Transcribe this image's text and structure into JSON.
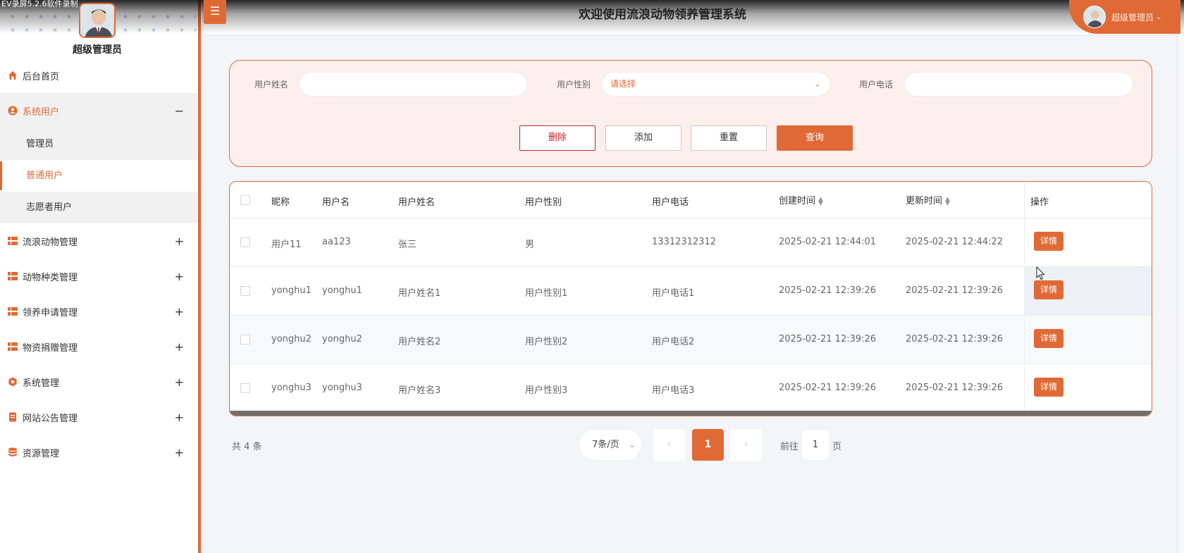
{
  "recorder_label": "EV录屏5.2.6软件录制",
  "header": {
    "menu_icon": "☰",
    "title": "欢迎使用流浪动物领养管理系统",
    "user": "超级管理员"
  },
  "sidebar": {
    "admin_name": "超级管理员",
    "items": [
      {
        "label": "后台首页",
        "icon": "home-icon"
      },
      {
        "label": "系统用户",
        "icon": "user-circle-icon",
        "toggle": "−",
        "expanded": true,
        "children": [
          {
            "label": "管理员"
          },
          {
            "label": "普通用户",
            "active": true
          },
          {
            "label": "志愿者用户"
          }
        ]
      },
      {
        "label": "流浪动物管理",
        "icon": "grid-icon",
        "toggle": "+"
      },
      {
        "label": "动物种类管理",
        "icon": "grid-icon",
        "toggle": "+"
      },
      {
        "label": "领养申请管理",
        "icon": "grid-icon",
        "toggle": "+"
      },
      {
        "label": "物资捐赠管理",
        "icon": "grid-icon",
        "toggle": "+"
      },
      {
        "label": "系统管理",
        "icon": "gear-icon",
        "toggle": "+"
      },
      {
        "label": "网站公告管理",
        "icon": "notice-icon",
        "toggle": "+"
      },
      {
        "label": "资源管理",
        "icon": "database-icon",
        "toggle": "+"
      }
    ]
  },
  "search": {
    "name_label": "用户姓名",
    "name_value": "",
    "gender_label": "用户性别",
    "gender_placeholder": "请选择",
    "phone_label": "用户电话",
    "phone_value": "",
    "buttons": {
      "delete": "删除",
      "add": "添加",
      "reset": "重置",
      "query": "查询"
    }
  },
  "table": {
    "headers": [
      "昵称",
      "用户名",
      "用户姓名",
      "用户性别",
      "用户电话",
      "创建时间",
      "更新时间",
      "操作"
    ],
    "rows": [
      {
        "nickname": "用户11",
        "username": "aa123",
        "realname": "张三",
        "gender": "男",
        "phone": "13312312312",
        "created": "2025-02-21 12:44:01",
        "updated": "2025-02-21 12:44:22",
        "action": "详情"
      },
      {
        "nickname": "yonghu1",
        "username": "yonghu1",
        "realname": "用户姓名1",
        "gender": "用户性别1",
        "phone": "用户电话1",
        "created": "2025-02-21 12:39:26",
        "updated": "2025-02-21 12:39:26",
        "action": "详情"
      },
      {
        "nickname": "yonghu2",
        "username": "yonghu2",
        "realname": "用户姓名2",
        "gender": "用户性别2",
        "phone": "用户电话2",
        "created": "2025-02-21 12:39:26",
        "updated": "2025-02-21 12:39:26",
        "action": "详情"
      },
      {
        "nickname": "yonghu3",
        "username": "yonghu3",
        "realname": "用户姓名3",
        "gender": "用户性别3",
        "phone": "用户电话3",
        "created": "2025-02-21 12:39:26",
        "updated": "2025-02-21 12:39:26",
        "action": "详情"
      }
    ]
  },
  "pagination": {
    "total": "共 4 条",
    "page_size": "7条/页",
    "prev": "‹",
    "current": "1",
    "next": "›",
    "goto_prefix": "前往",
    "goto_value": "1",
    "goto_suffix": "页"
  },
  "colors": {
    "accent": "#e06a35",
    "danger": "#c3232f",
    "panel_bg": "#fcefec"
  }
}
